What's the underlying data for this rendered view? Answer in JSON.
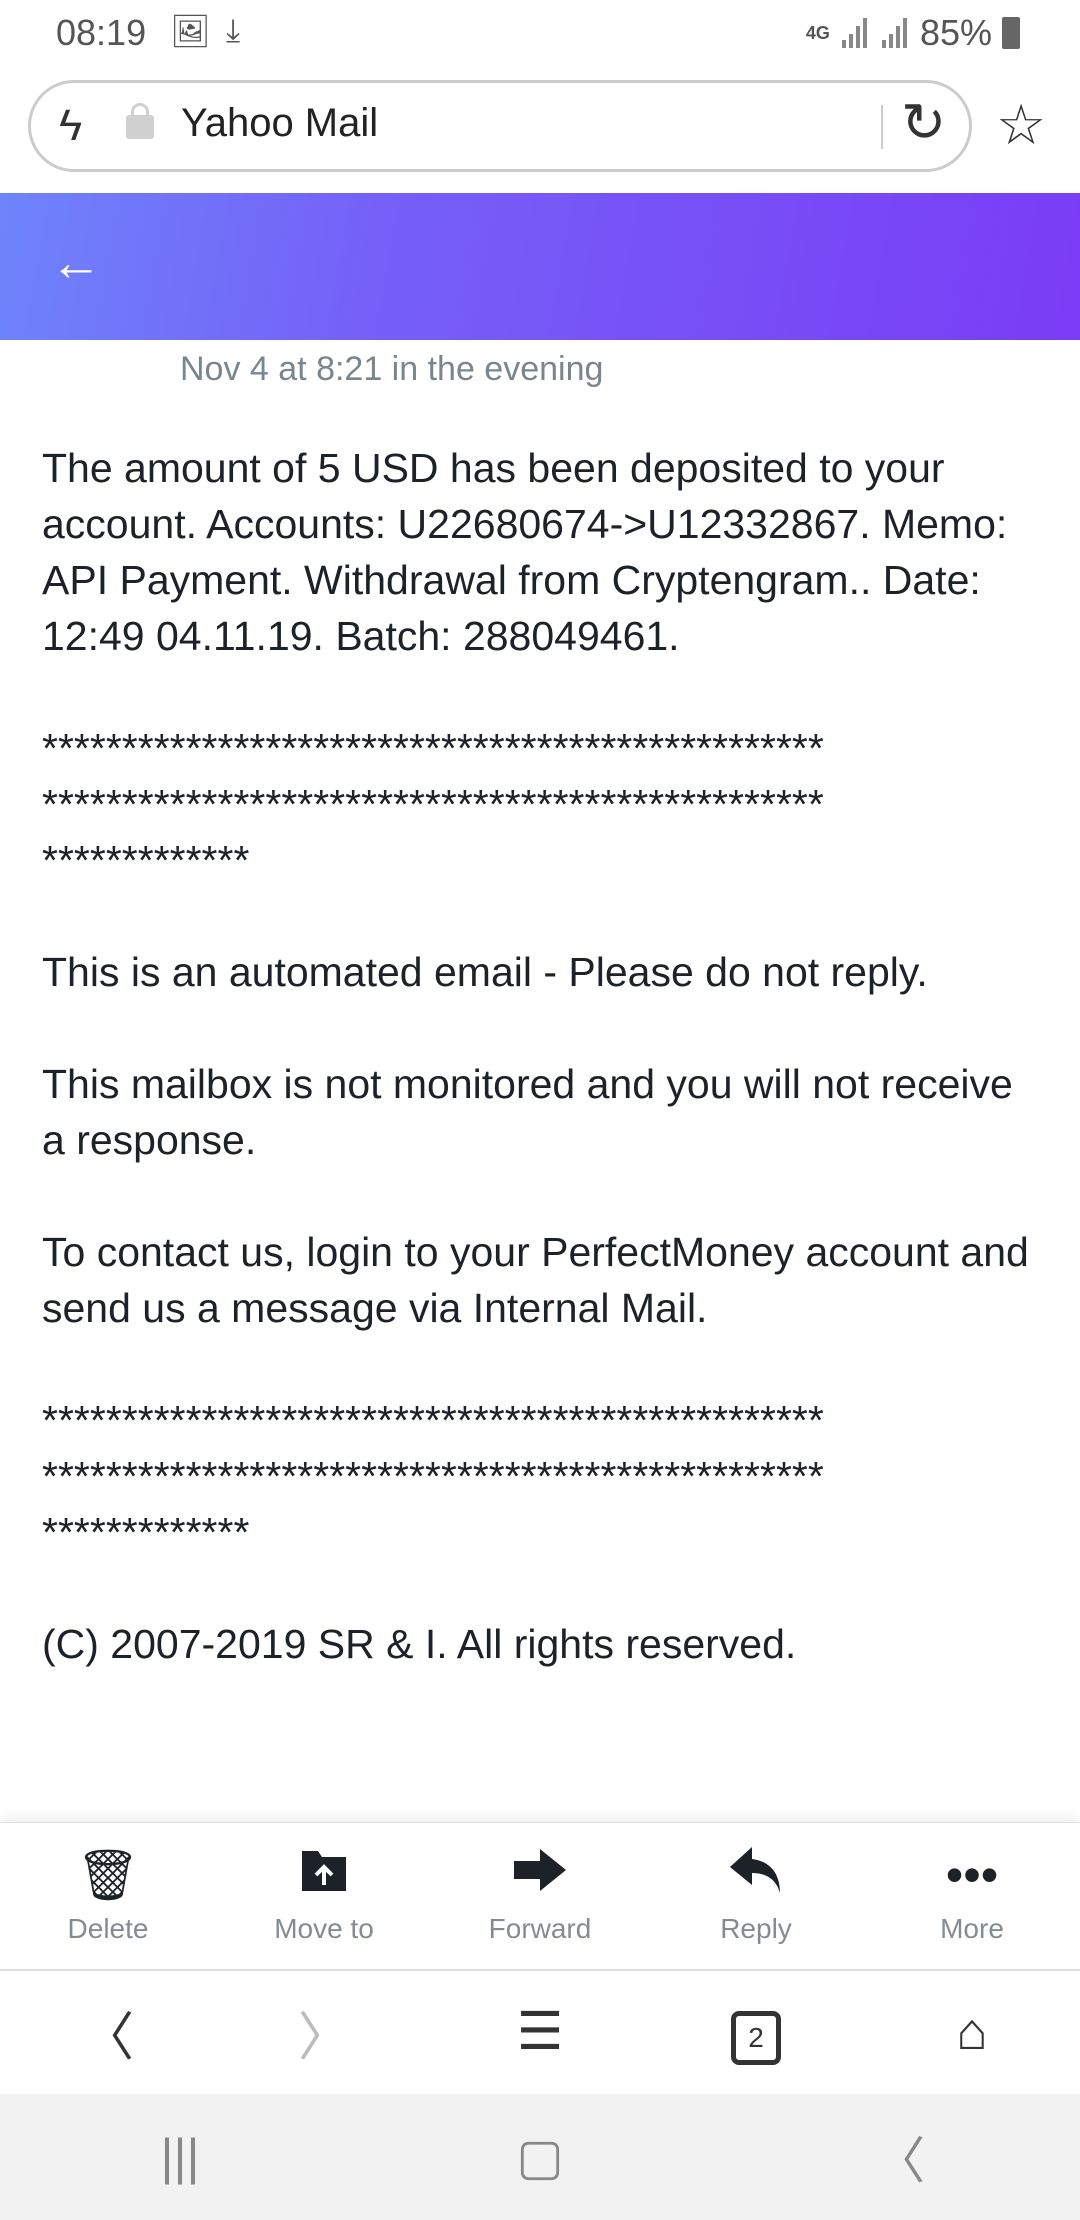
{
  "status_bar": {
    "time": "08:19",
    "network": "4G",
    "battery": "85%"
  },
  "browser": {
    "page_title": "Yahoo Mail",
    "tab_count": "2"
  },
  "email": {
    "date": "Nov 4 at 8:21 in the evening",
    "paragraph1": "The amount of 5 USD has been deposited to your account. Accounts: U22680674->U12332867. Memo: API Payment. Withdrawal from Cryptengram.. Date: 12:49 04.11.19. Batch: 288049461.",
    "separator_lines": [
      "*************************************************",
      "*************************************************",
      "*************"
    ],
    "paragraph2": "This is an automated email - Please do not reply.",
    "paragraph3": "This mailbox is not monitored and you will not receive a response.",
    "paragraph4": "To contact us, login to your PerfectMoney account and send us a message via Internal Mail.",
    "copyright": "(C) 2007-2019 SR & I. All rights reserved."
  },
  "actions": [
    {
      "label": "Delete",
      "icon": "trash-icon"
    },
    {
      "label": "Move to",
      "icon": "folder-move-icon"
    },
    {
      "label": "Forward",
      "icon": "forward-icon"
    },
    {
      "label": "Reply",
      "icon": "reply-icon"
    },
    {
      "label": "More",
      "icon": "more-icon"
    }
  ],
  "colors": {
    "header_gradient_start": "#6e84fa",
    "header_gradient_end": "#7a3cf5"
  }
}
